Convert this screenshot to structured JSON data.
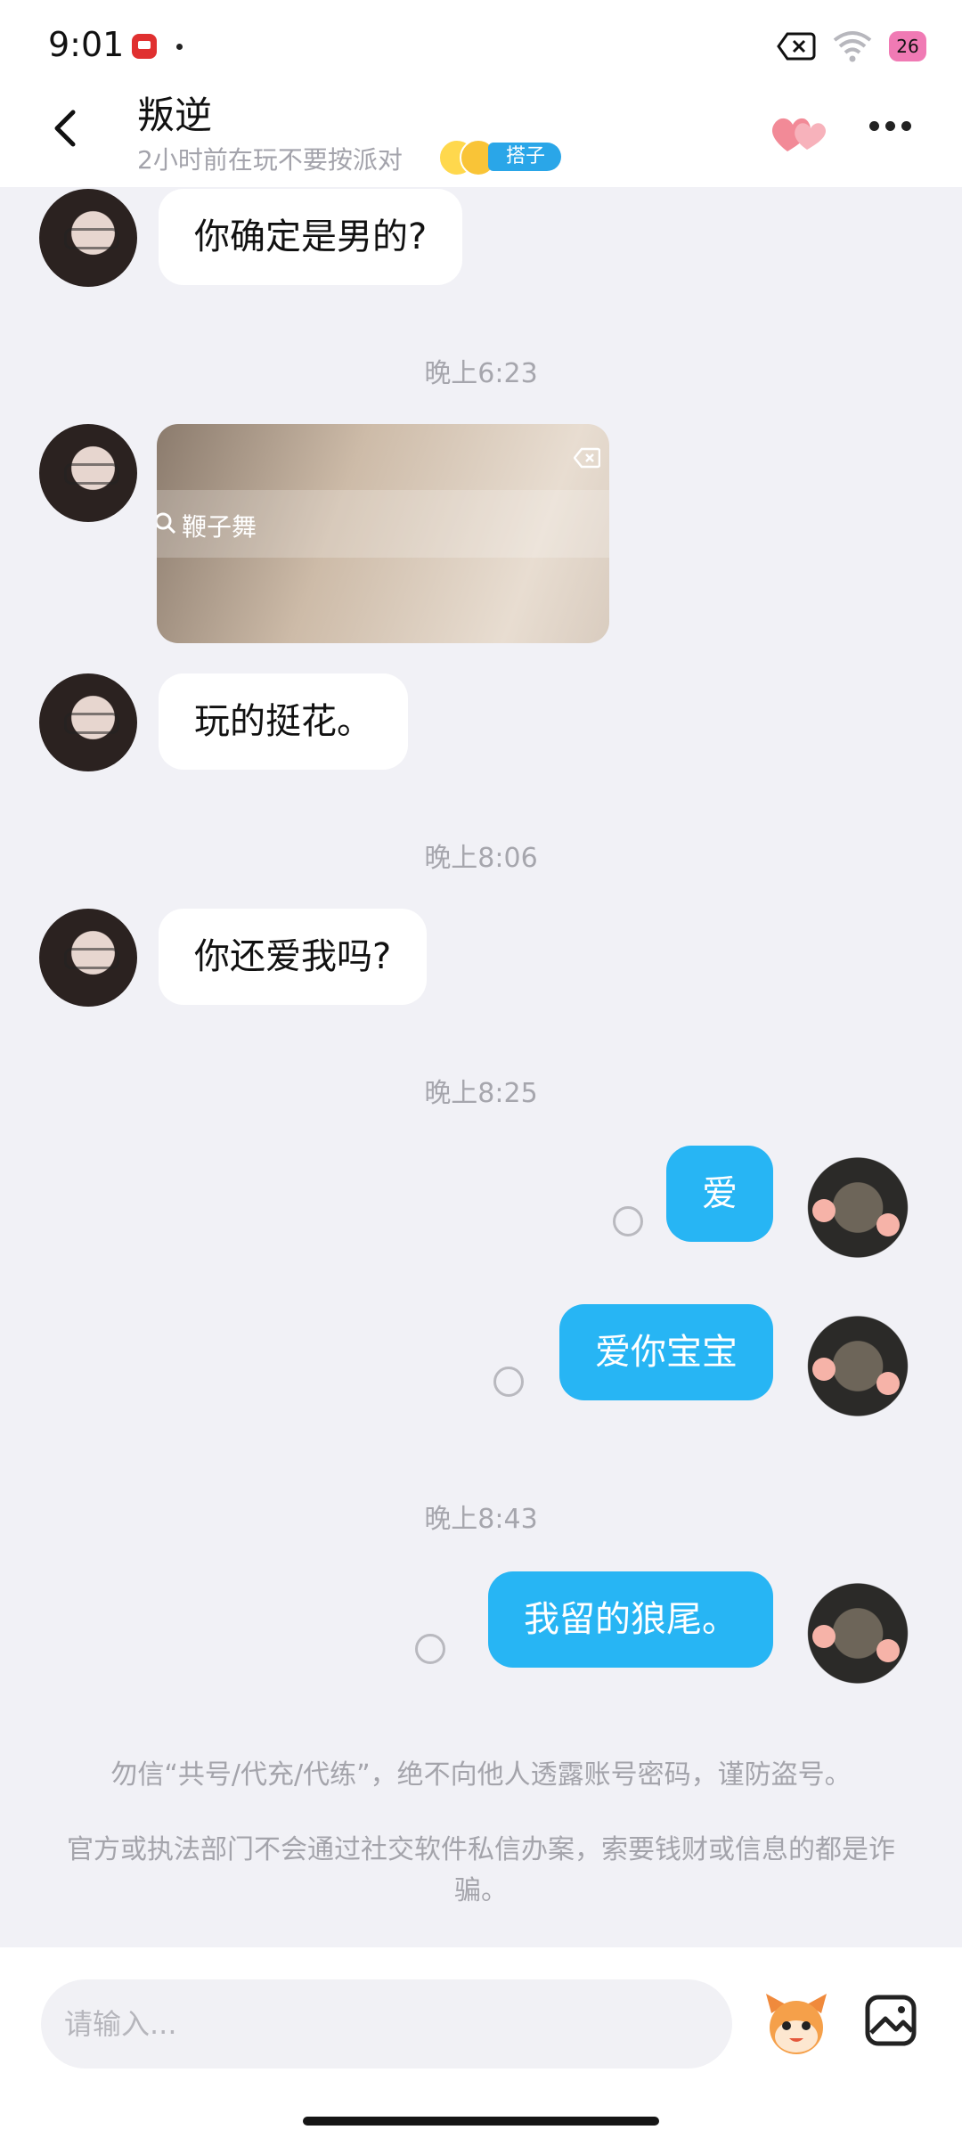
{
  "status_bar": {
    "time": "9:01",
    "battery_level": "26",
    "icons": [
      "app-notification-icon",
      "dot-icon",
      "close-box-icon",
      "wifi-icon",
      "battery-heart-icon"
    ]
  },
  "header": {
    "title": "叛逆",
    "subtitle": "2小时前在玩不要按派对",
    "tag": "搭子",
    "icons": [
      "back-icon",
      "heart-icon",
      "more-icon"
    ]
  },
  "messages": {
    "m1": "你确定是男的?",
    "t1": "晚上6:23",
    "image_text": "鞭子舞",
    "m2": "玩的挺花。",
    "t2": "晚上8:06",
    "m3": "你还爱我吗?",
    "t3": "晚上8:25",
    "m4": "爱",
    "m5": "爱你宝宝",
    "t4": "晚上8:43",
    "m6": "我留的狼尾。"
  },
  "notices": {
    "line1": "勿信“共号/代充/代练”，绝不向他人透露账号密码，谨防盗号。",
    "line2": "官方或执法部门不会通过社交软件私信办案，索要钱财或信息的都是诈骗。"
  },
  "input": {
    "placeholder": "请输入..."
  },
  "colors": {
    "accent": "#27b5f4",
    "background": "#f1f1f6",
    "tag": "#2aa6e8",
    "heart": "#f28a97"
  }
}
